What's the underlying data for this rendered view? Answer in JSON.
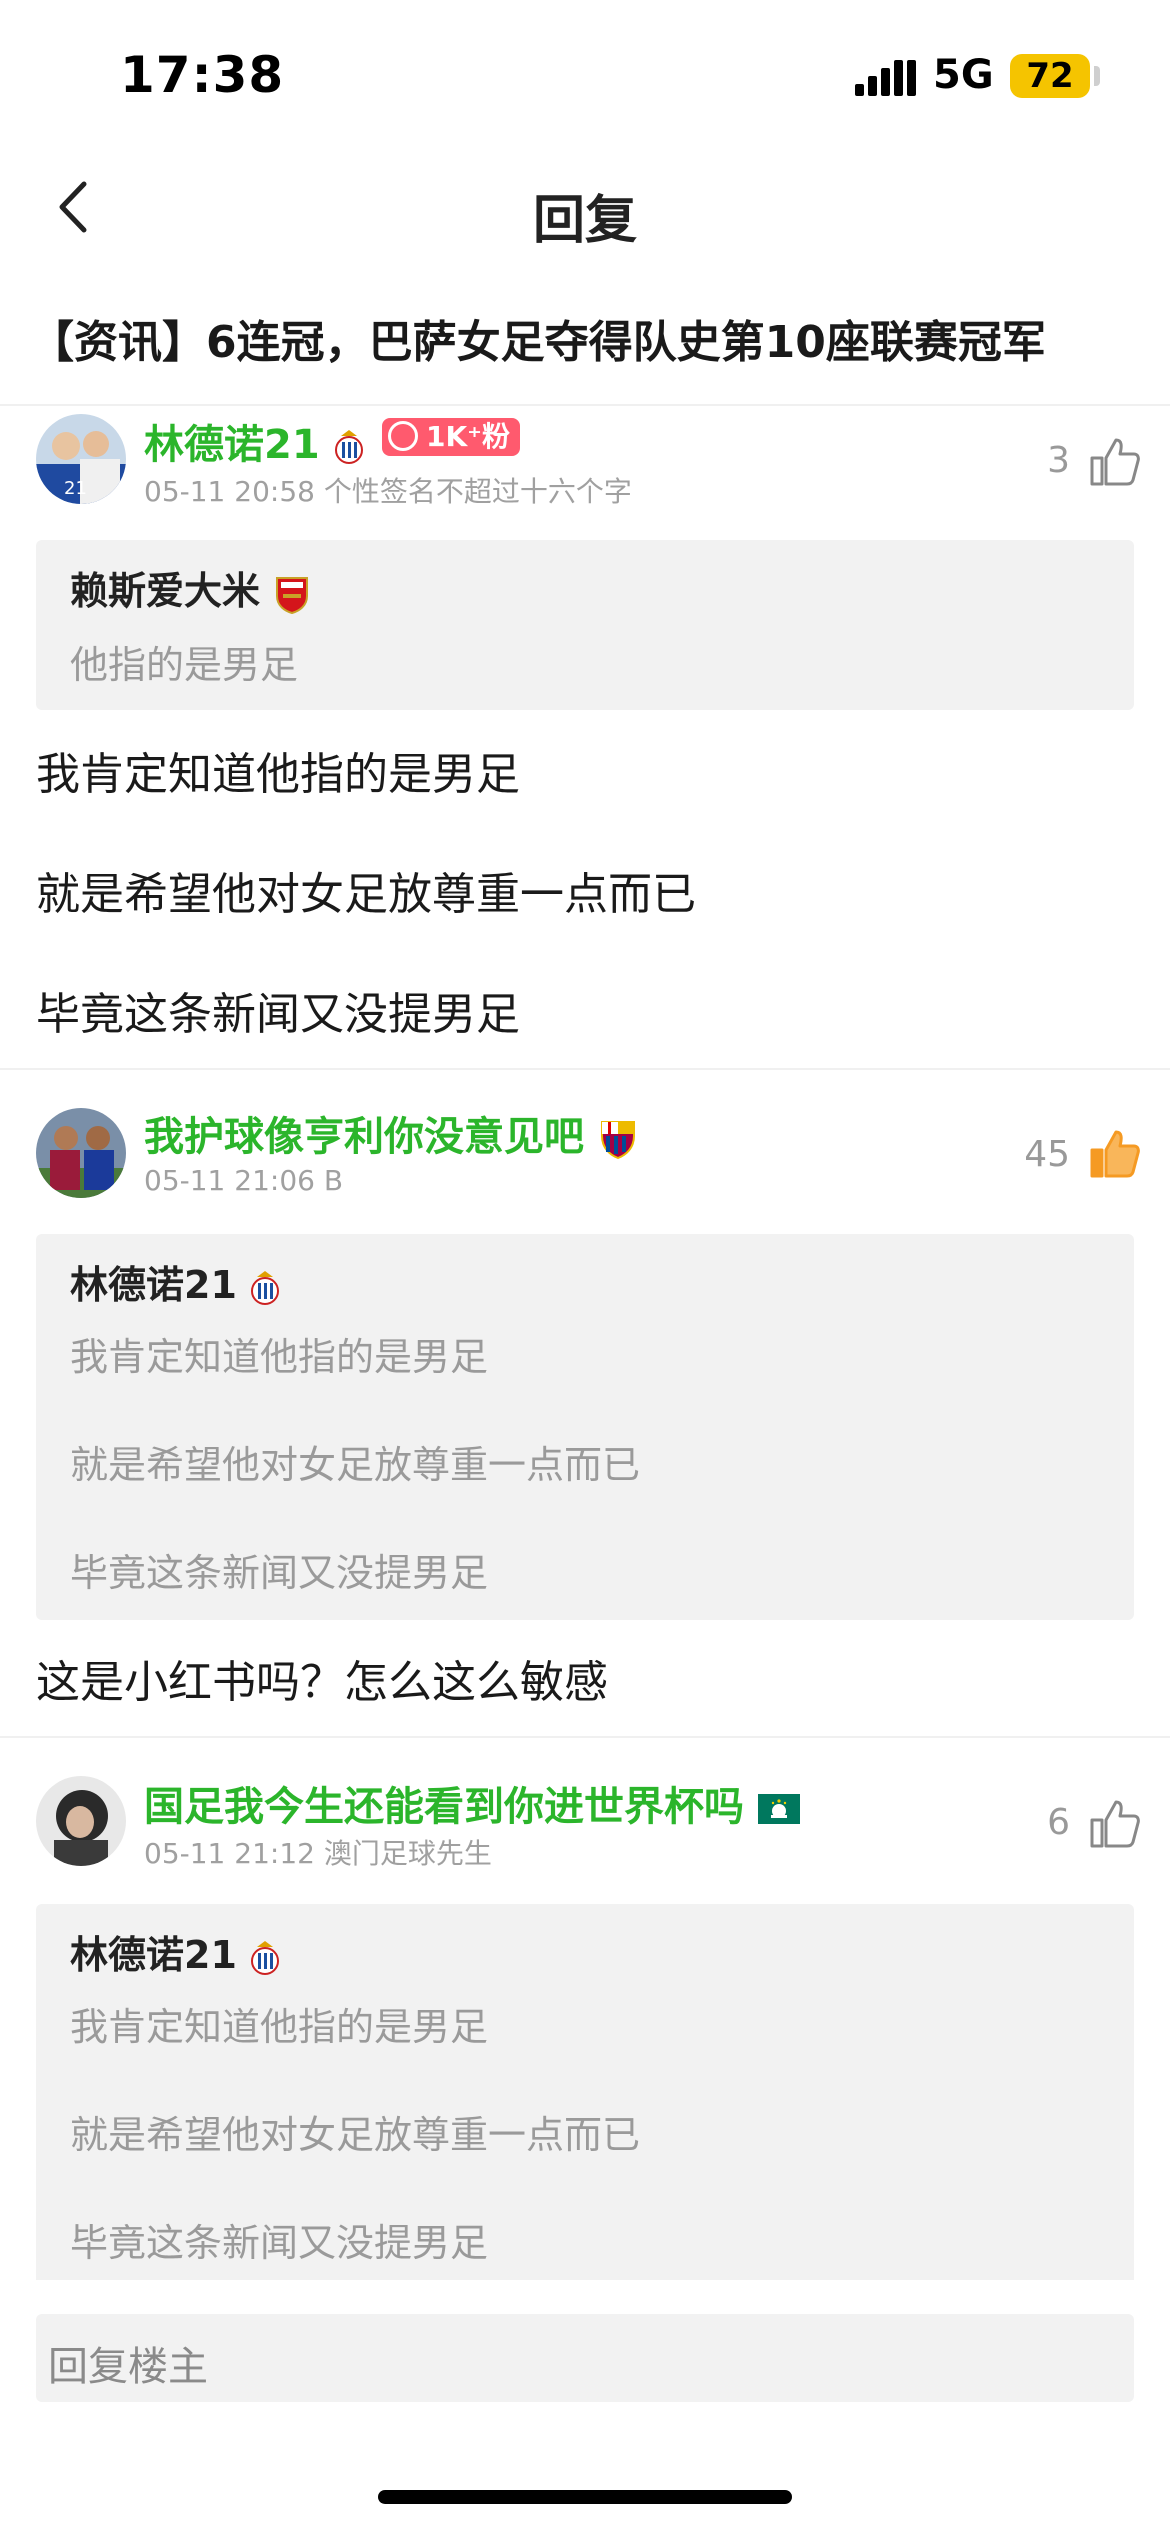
{
  "status": {
    "time": "17:38",
    "network": "5G",
    "battery": "72"
  },
  "nav": {
    "title": "回复"
  },
  "thread": {
    "title": "【资讯】6连冠，巴萨女足夺得队史第10座联赛冠军"
  },
  "posts": [
    {
      "username": "林德诺21",
      "fans": "1K⁺粉",
      "meta": "05-11 20:58 个性签名不超过十六个字",
      "likes": "3",
      "quote": {
        "user": "赖斯爱大米",
        "lines": [
          "他指的是男足"
        ]
      },
      "body": [
        "我肯定知道他指的是男足",
        "就是希望他对女足放尊重一点而已",
        "毕竟这条新闻又没提男足"
      ]
    },
    {
      "username": "我护球像亨利你没意见吧",
      "meta": "05-11 21:06 B",
      "likes": "45",
      "quote": {
        "user": "林德诺21",
        "lines": [
          "我肯定知道他指的是男足",
          "就是希望他对女足放尊重一点而已",
          "毕竟这条新闻又没提男足"
        ]
      },
      "body": [
        "这是小红书吗？怎么这么敏感"
      ]
    },
    {
      "username": "国足我今生还能看到你进世界杯吗",
      "meta": "05-11 21:12 澳门足球先生",
      "likes": "6",
      "quote": {
        "user": "林德诺21",
        "lines": [
          "我肯定知道他指的是男足",
          "就是希望他对女足放尊重一点而已",
          "毕竟这条新闻又没提男足"
        ]
      },
      "body": []
    }
  ],
  "reply": {
    "placeholder": "回复楼主"
  },
  "colors": {
    "username": "#2bb52b",
    "like_active": "#f59a23",
    "fans_badge": "#ff5a6e",
    "battery": "#f5c400"
  }
}
